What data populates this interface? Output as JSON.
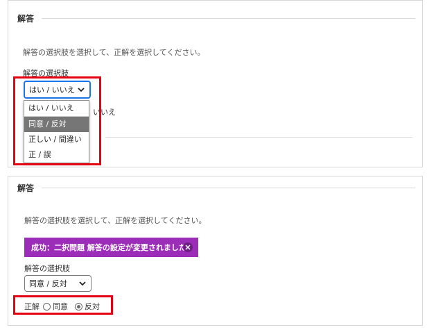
{
  "top": {
    "section_title": "解答",
    "instruction": "解答の選択肢を選択して、正解を選択してください。",
    "choice_label": "解答の選択肢",
    "select_value": "はい / いいえ",
    "options": [
      "はい / いいえ",
      "同意 / 反対",
      "正しい / 間違い",
      "正 / 誤"
    ],
    "highlighted_option": "同意 / 反対",
    "obscured_text": "いいえ"
  },
  "bottom": {
    "section_title": "解答",
    "instruction": "解答の選択肢を選択して、正解を選択してください。",
    "success_message": "成功：二択問題 解答の設定が変更されました。",
    "choice_label": "解答の選択肢",
    "select_value": "同意 / 反対",
    "answer_label": "正解",
    "radio_options": [
      {
        "label": "同意",
        "checked": false
      },
      {
        "label": "反対",
        "checked": true
      }
    ]
  },
  "colors": {
    "highlight_box": "#e60012",
    "banner_bg": "#9c2db8",
    "selected_option_bg": "#767676",
    "focus_border": "#1a73e8"
  }
}
